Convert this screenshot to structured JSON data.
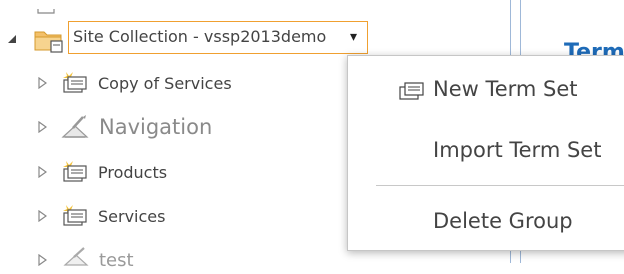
{
  "tree": {
    "root": {
      "label": "Site Collection - vssp2013demo",
      "dropdown_glyph": "▾",
      "icon": "site-collection-folder-icon",
      "expanded": true
    },
    "children": [
      {
        "label": "Copy of Services",
        "icon": "term-set-icon"
      },
      {
        "label": "Navigation",
        "icon": "navigation-term-set-icon"
      },
      {
        "label": "Products",
        "icon": "term-set-icon"
      },
      {
        "label": "Services",
        "icon": "term-set-icon"
      },
      {
        "label": "test",
        "icon": "navigation-term-set-icon"
      }
    ]
  },
  "right_panel": {
    "heading_fragment": "Term"
  },
  "context_menu": {
    "items": [
      {
        "label": "New Term Set",
        "icon": "new-term-set-icon"
      },
      {
        "label": "Import Term Set"
      },
      {
        "label": "Delete Group"
      }
    ]
  },
  "colors": {
    "selection_border": "#f0a030",
    "accent_blue": "#1e6bb8",
    "text": "#444444",
    "faded_text": "#9a9a9a"
  }
}
